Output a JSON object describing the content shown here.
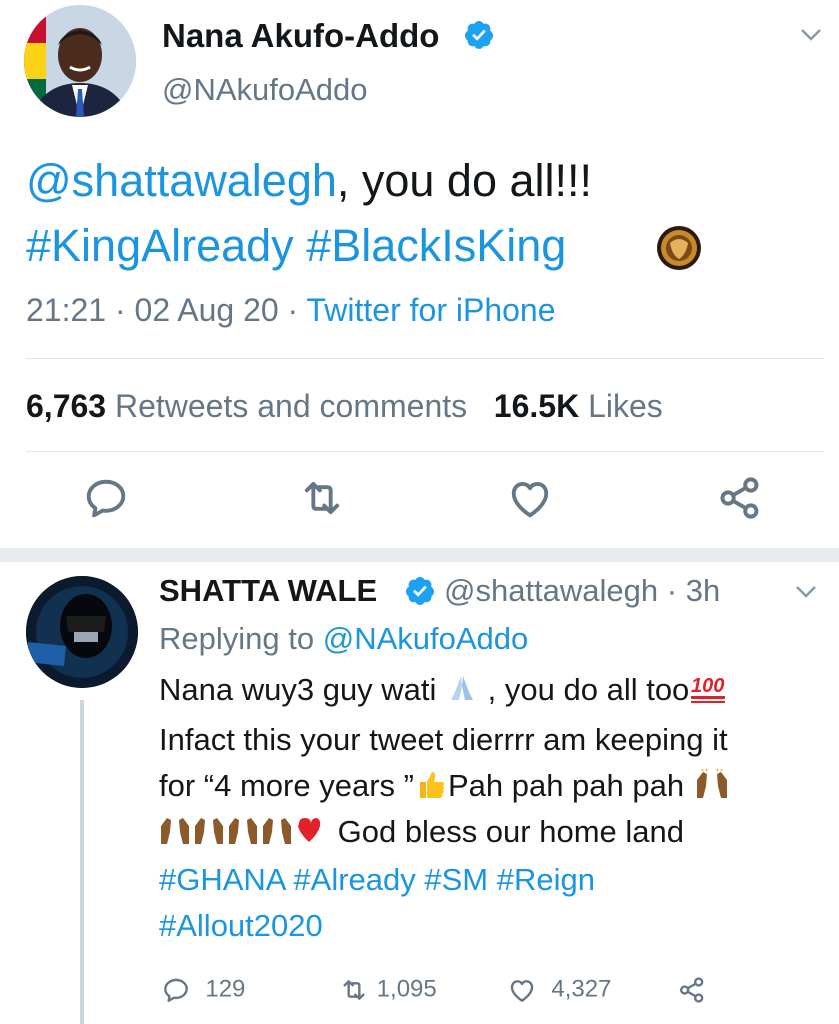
{
  "main_tweet": {
    "author_name": "Nana Akufo-Addo",
    "author_handle": "@NAkufoAddo",
    "mention": "@shattawalegh",
    "text_after_mention": ", you do all!!!",
    "hashtags": [
      "#KingAlready",
      "#BlackIsKing"
    ],
    "time": "21:21",
    "date": "02 Aug 20",
    "source": "Twitter for iPhone",
    "retweets_count": "6,763",
    "retweets_label": "Retweets and comments",
    "likes_count": "16.5K",
    "likes_label": "Likes"
  },
  "reply": {
    "author_name": "SHATTA WALE",
    "author_handle": "@shattawalegh",
    "age": "3h",
    "replying_prefix": "Replying to ",
    "replying_to": "@NAkufoAddo",
    "line1a": "Nana wuy3 guy wati ",
    "line1b": " , you do all too",
    "line2": "Infact this your tweet dierrrr am keeping it",
    "line3a": "for “4 more years ”",
    "line3b": "Pah pah pah pah ",
    "line4": " God bless our home land",
    "hashtags_line1": [
      "#GHANA",
      "#Already",
      "#SM",
      "#Reign"
    ],
    "hashtags_line2": "#Allout2020",
    "reply_count": "129",
    "retweet_count": "1,095",
    "like_count": "4,327"
  },
  "colors": {
    "link_blue": "#1b95e0",
    "gray_text": "#657786",
    "icon_gray": "#657786",
    "verified_blue": "#1da1f2"
  },
  "icons": [
    "chevron-down-icon",
    "verified-badge-icon",
    "reply-icon",
    "retweet-icon",
    "like-icon",
    "share-icon",
    "hashflag-icon",
    "praying-hands-emoji",
    "hundred-points-emoji",
    "thumbs-up-emoji",
    "raising-hands-emoji",
    "red-heart-emoji"
  ]
}
